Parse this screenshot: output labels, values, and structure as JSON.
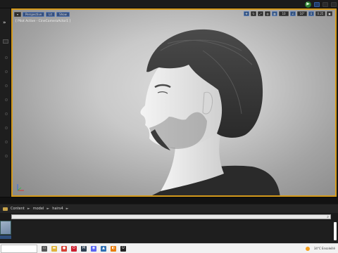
{
  "topbar": {
    "play_icon": "play-circle-icon",
    "right_buttons": [
      "",
      "",
      ""
    ]
  },
  "viewport": {
    "toolbar": {
      "dropdown_glyph": "▾",
      "perspective": "Perspective",
      "lit": "Lit",
      "show": "Show",
      "tools": [
        "✥",
        "↻",
        "⤢",
        "◍",
        "▦",
        "10",
        "∠",
        "10°",
        "⌗",
        "0.25",
        "▣"
      ]
    },
    "pilot_label": "[ Pilot Active - CineCameraActor1 ]",
    "accent_color": "#d49a1c"
  },
  "content_browser": {
    "breadcrumbs": [
      "Content",
      "model",
      "hairs4"
    ],
    "separator": "►"
  },
  "taskbar": {
    "search_placeholder": "",
    "apps": [
      {
        "icon": "task-view-icon",
        "glyph": "▭",
        "color": "#555555"
      },
      {
        "icon": "file-explorer-icon",
        "glyph": "▬",
        "color": "#e0b23c"
      },
      {
        "icon": "chrome-icon",
        "glyph": "●",
        "color": "#d64035"
      },
      {
        "icon": "opera-icon",
        "glyph": "O",
        "color": "#cc1f2f"
      },
      {
        "icon": "marmoset-icon",
        "glyph": "M",
        "color": "#2d3e50"
      },
      {
        "icon": "discord-icon",
        "glyph": "◉",
        "color": "#5865f2"
      },
      {
        "icon": "photo-icon",
        "glyph": "▲",
        "color": "#2f6fb3"
      },
      {
        "icon": "blender-icon",
        "glyph": "◐",
        "color": "#e87d0d"
      },
      {
        "icon": "unreal-icon",
        "glyph": "U",
        "color": "#222222"
      }
    ],
    "weather": "34°C Ensoleillé"
  },
  "colors": {
    "viewport_border": "#d49a1c",
    "taskbar_bg": "#f2f2f2"
  }
}
